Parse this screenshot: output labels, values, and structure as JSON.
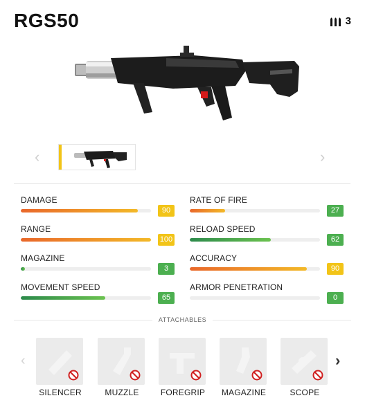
{
  "weapon": {
    "name": "RGS50",
    "ammo_count": "3",
    "ammo_icon": "bullets-icon"
  },
  "colors": {
    "accent_yellow": "#f2c418",
    "badge_green": "#4caf50",
    "bar_orange_start": "#e9672a",
    "bar_orange_end": "#f3b928",
    "bar_green_start": "#2c8a4b",
    "bar_green_end": "#6bc24f"
  },
  "stats": [
    {
      "label": "DAMAGE",
      "value": "90",
      "fraction": 0.9,
      "bar": "orange",
      "badge": "yellow"
    },
    {
      "label": "RATE OF FIRE",
      "value": "27",
      "fraction": 0.27,
      "bar": "orange",
      "badge": "green"
    },
    {
      "label": "RANGE",
      "value": "100",
      "fraction": 1.0,
      "bar": "orange",
      "badge": "yellow"
    },
    {
      "label": "RELOAD SPEED",
      "value": "62",
      "fraction": 0.62,
      "bar": "green",
      "badge": "green"
    },
    {
      "label": "MAGAZINE",
      "value": "3",
      "fraction": 0.03,
      "bar": "green",
      "badge": "green"
    },
    {
      "label": "ACCURACY",
      "value": "90",
      "fraction": 0.9,
      "bar": "orange",
      "badge": "yellow"
    },
    {
      "label": "MOVEMENT SPEED",
      "value": "65",
      "fraction": 0.65,
      "bar": "green",
      "badge": "green"
    },
    {
      "label": "ARMOR PENETRATION",
      "value": "0",
      "fraction": 0.0,
      "bar": "green",
      "badge": "green"
    }
  ],
  "attachables": {
    "title": "ATTACHABLES",
    "slots": [
      {
        "label": "SILENCER",
        "icon": "silencer-icon",
        "status_icon": "unavailable-icon"
      },
      {
        "label": "MUZZLE",
        "icon": "muzzle-icon",
        "status_icon": "unavailable-icon"
      },
      {
        "label": "FOREGRIP",
        "icon": "foregrip-icon",
        "status_icon": "unavailable-icon"
      },
      {
        "label": "MAGAZINE",
        "icon": "magazine-icon",
        "status_icon": "unavailable-icon"
      },
      {
        "label": "SCOPE",
        "icon": "scope-icon",
        "status_icon": "unavailable-icon"
      }
    ]
  }
}
